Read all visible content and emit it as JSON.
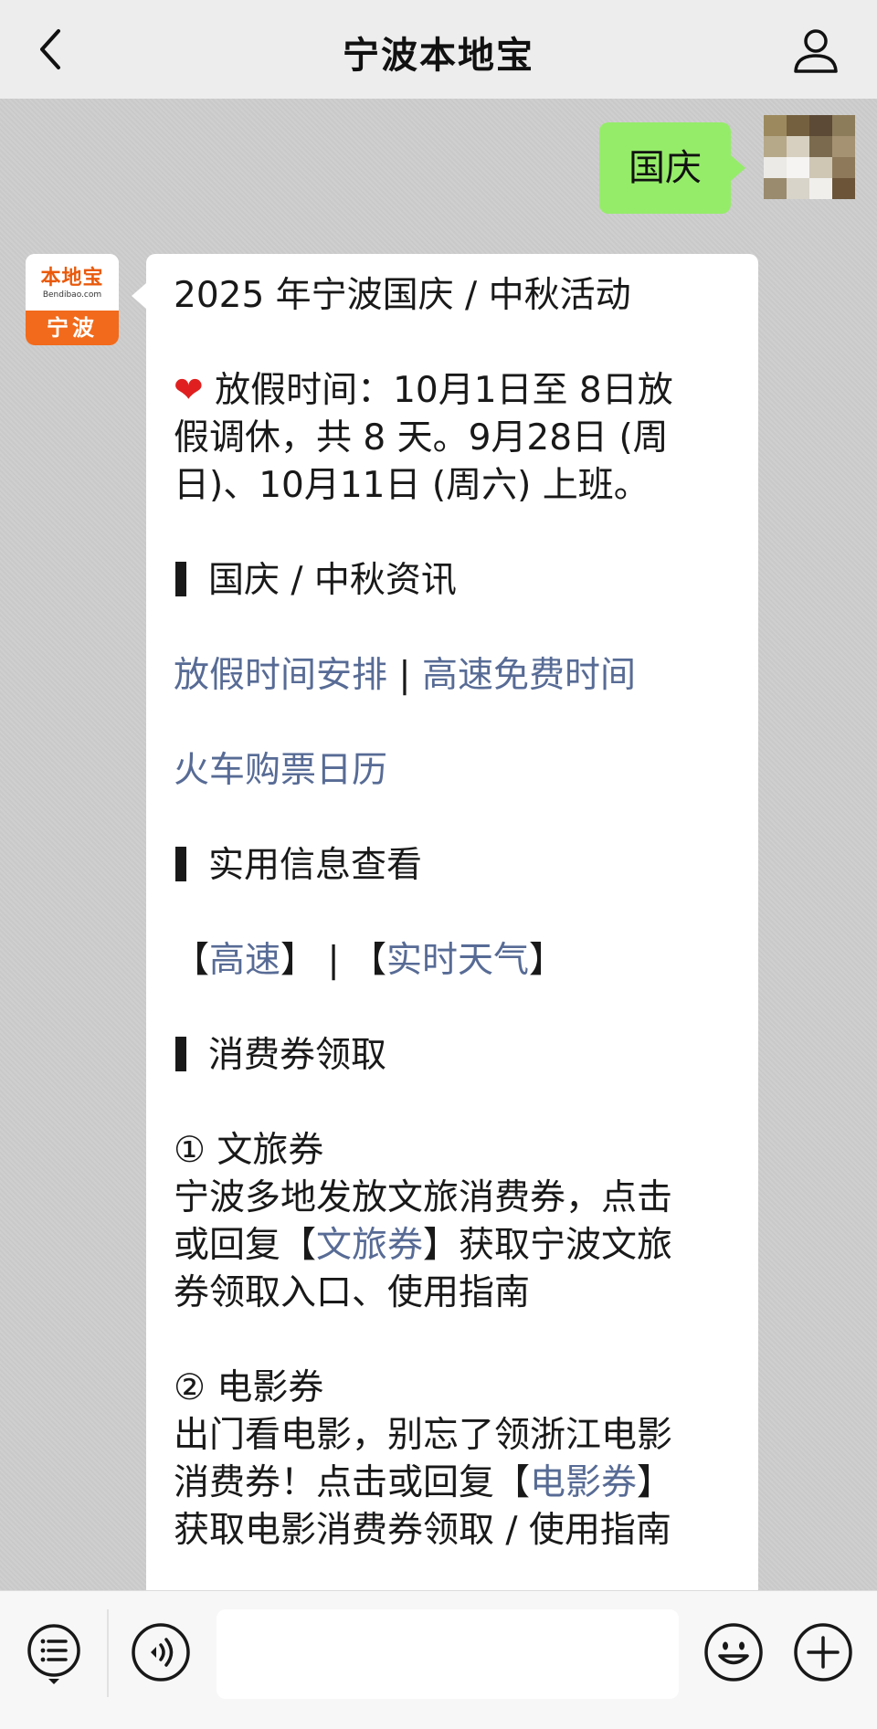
{
  "header": {
    "title": "宁波本地宝",
    "back_icon": "chevron-left-icon",
    "profile_icon": "user-icon"
  },
  "chat": {
    "user_message": "国庆",
    "bot_avatar": {
      "logo_text": "本地宝",
      "logo_url": "Bendibao.com",
      "city": "宁波"
    },
    "reply": {
      "title": "2025 年宁波国庆 / 中秋活动",
      "holiday_line1": "放假时间：10月1日至 8日放",
      "holiday_line2": "假调休，共 8 天。9月28日 (周",
      "holiday_line3": "日)、10月11日 (周六) 上班。",
      "section1": "国庆 / 中秋资讯",
      "link_holiday": "放假时间安排",
      "separator": "|",
      "link_highway_free": "高速免费时间",
      "link_train": "火车购票日历",
      "section2": "实用信息查看",
      "bracket_open": "【",
      "bracket_close": "】",
      "link_highway": "高速",
      "link_weather": "实时天气",
      "section3": "消费券领取",
      "coupon1_title": "① 文旅券",
      "coupon1_line1": "宁波多地发放文旅消费券，点击",
      "coupon1_line2_pre": "或回复【",
      "coupon1_link": "文旅券",
      "coupon1_line2_post": "】获取宁波文旅",
      "coupon1_line3": "券领取入口、使用指南",
      "coupon2_title": "② 电影券",
      "coupon2_line1": "出门看电影，别忘了领浙江电影",
      "coupon2_line2_pre": "消费券！点击或回复【",
      "coupon2_link": "电影券",
      "coupon2_line2_post": "】",
      "coupon2_line3": "获取电影消费券领取 / 使用指南"
    }
  },
  "input_bar": {
    "menu_icon": "menu-list-icon",
    "voice_icon": "voice-icon",
    "input_value": "",
    "emoji_icon": "emoji-icon",
    "plus_icon": "plus-icon"
  },
  "colors": {
    "link": "#576b95",
    "user_bubble": "#95ec69",
    "brand": "#f26a1b"
  }
}
